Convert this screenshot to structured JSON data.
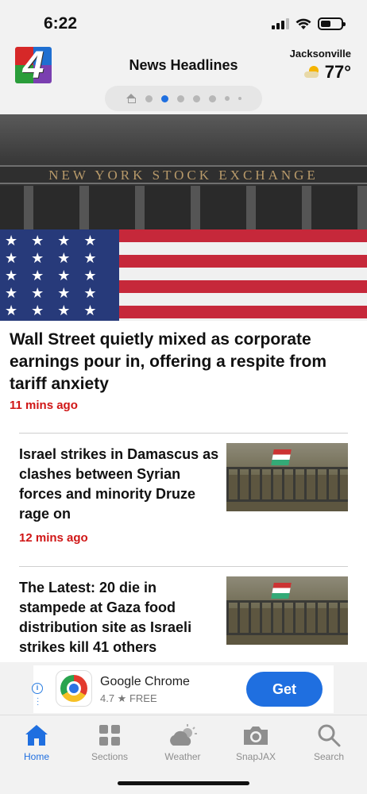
{
  "status_bar": {
    "time": "6:22"
  },
  "header": {
    "logo_text": "4",
    "title": "News Headlines",
    "weather": {
      "city": "Jacksonville",
      "temp": "77°"
    },
    "pager": {
      "pages": 8,
      "active_index": 1
    }
  },
  "lead_story": {
    "frieze_text": "NEW YORK STOCK EXCHANGE",
    "title": "Wall Street quietly mixed as corporate earnings pour in, offering a respite from tariff anxiety",
    "time": "11 mins ago"
  },
  "stories": [
    {
      "title": "Israel strikes in Damascus as clashes between Syrian forces and minority Druze rage on",
      "time": "12 mins ago"
    },
    {
      "title": "The Latest: 20 die in stampede at Gaza food distribution site as Israeli strikes kill 41 others",
      "time": ""
    }
  ],
  "ad": {
    "app_name": "Google Chrome",
    "rating": "4.7 ★  FREE",
    "cta": "Get"
  },
  "tabs": [
    {
      "label": "Home",
      "active": true
    },
    {
      "label": "Sections",
      "active": false
    },
    {
      "label": "Weather",
      "active": false
    },
    {
      "label": "SnapJAX",
      "active": false
    },
    {
      "label": "Search",
      "active": false
    }
  ],
  "colors": {
    "accent": "#1f6fe0",
    "timestamp": "#d01616"
  }
}
